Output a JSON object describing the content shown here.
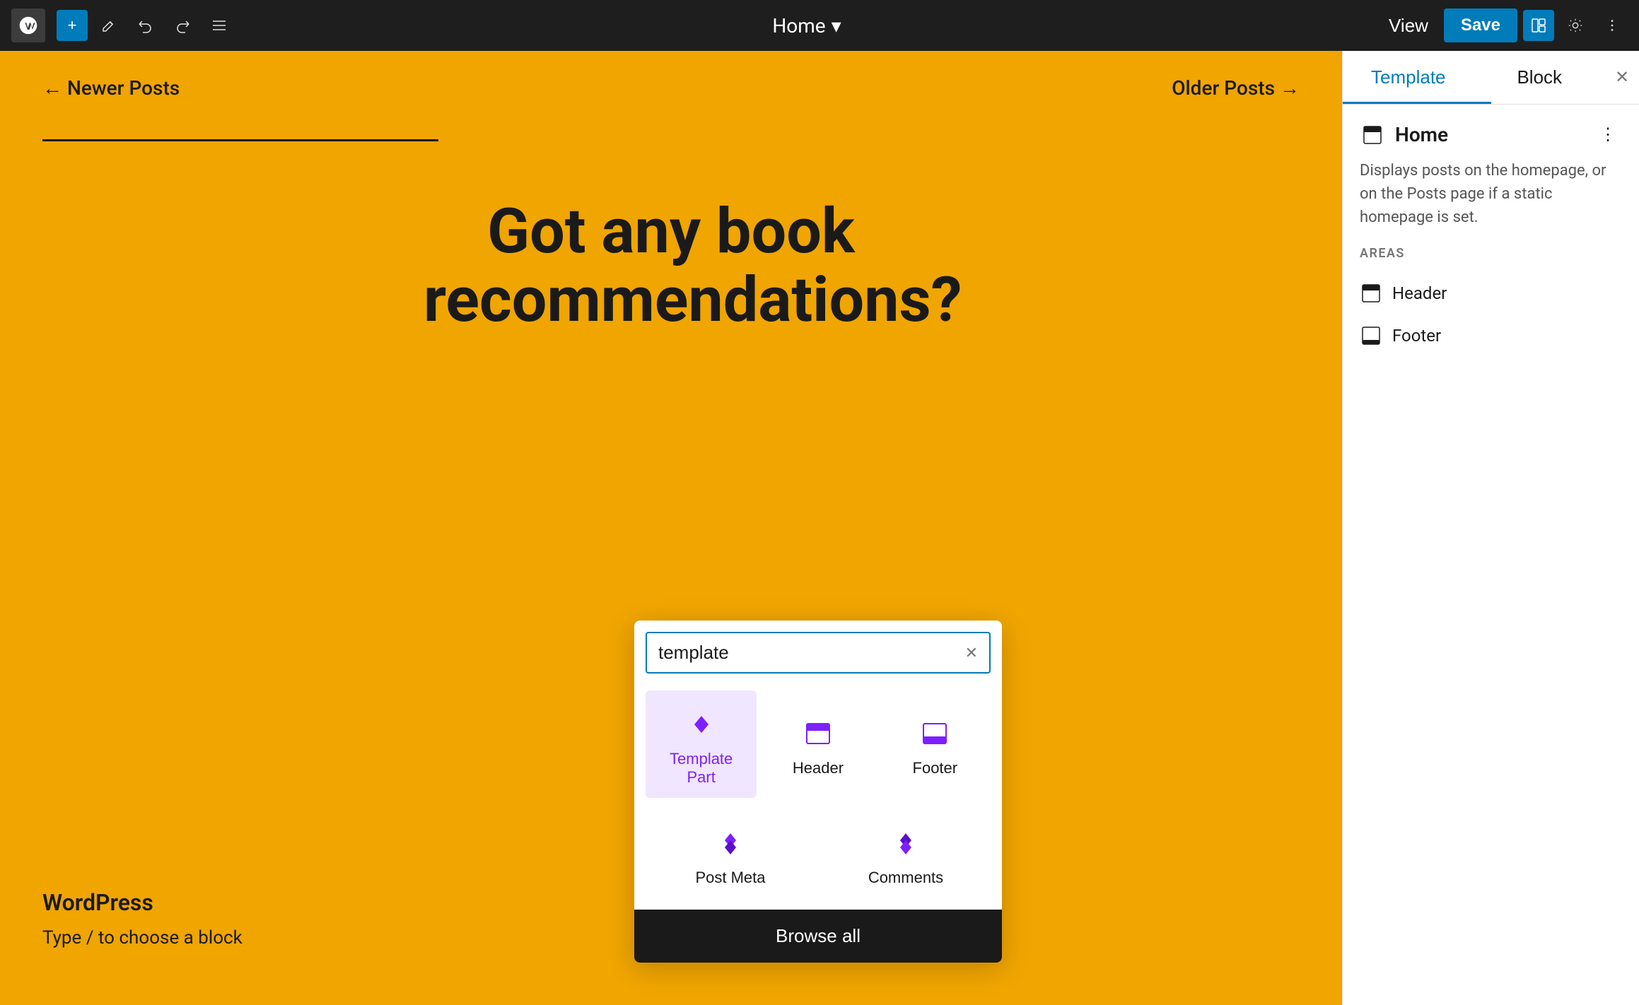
{
  "toolbar": {
    "add_label": "+",
    "page_title": "Home",
    "page_title_chevron": "▾",
    "view_label": "View",
    "save_label": "Save",
    "undo_title": "Undo",
    "redo_title": "Redo",
    "list_view_title": "List View"
  },
  "canvas": {
    "newer_posts": "← Newer Posts",
    "older_posts": "Older Posts →",
    "headline": "Got any book recommendations?",
    "footer_brand": "WordPress",
    "type_hint": "Type / to choose a block"
  },
  "inserter": {
    "search_value": "template",
    "search_placeholder": "Search",
    "items_row1": [
      {
        "id": "template-part",
        "label": "Template Part",
        "active": true
      },
      {
        "id": "header",
        "label": "Header",
        "active": false
      },
      {
        "id": "footer",
        "label": "Footer",
        "active": false
      }
    ],
    "items_row2": [
      {
        "id": "post-meta",
        "label": "Post Meta",
        "active": false
      },
      {
        "id": "comments",
        "label": "Comments",
        "active": false
      }
    ],
    "browse_all_label": "Browse all"
  },
  "right_panel": {
    "tab_template": "Template",
    "tab_block": "Block",
    "active_tab": "template",
    "template_name": "Home",
    "template_description": "Displays posts on the homepage, or on the Posts page if a static homepage is set.",
    "areas_label": "AREAS",
    "areas": [
      {
        "id": "header",
        "name": "Header"
      },
      {
        "id": "footer",
        "name": "Footer"
      }
    ]
  },
  "colors": {
    "canvas_bg": "#f0a500",
    "accent_blue": "#007cba",
    "accent_purple": "#7e1fff",
    "dark_purple": "#5b0ecc",
    "toolbar_bg": "#1e1e1e"
  }
}
